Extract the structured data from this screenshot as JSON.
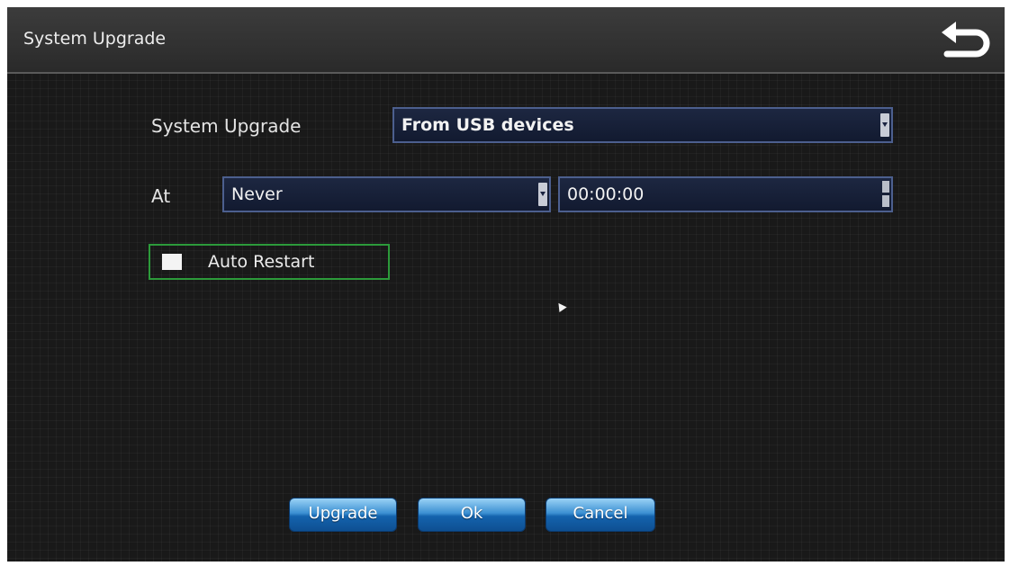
{
  "window": {
    "title": "System Upgrade",
    "back_icon": "back-arrow-icon"
  },
  "form": {
    "upgrade_label": "System Upgrade",
    "upgrade_source": "From USB devices",
    "at_label": "At",
    "schedule": "Never",
    "time": "00:00:00",
    "auto_restart_label": "Auto Restart",
    "auto_restart_checked": false
  },
  "buttons": {
    "upgrade": "Upgrade",
    "ok": "Ok",
    "cancel": "Cancel"
  },
  "colors": {
    "panel_bg": "#191919",
    "field_border": "#4c5f8e",
    "focus_border": "#2c9a3a",
    "button_blue": "#1463ad"
  }
}
